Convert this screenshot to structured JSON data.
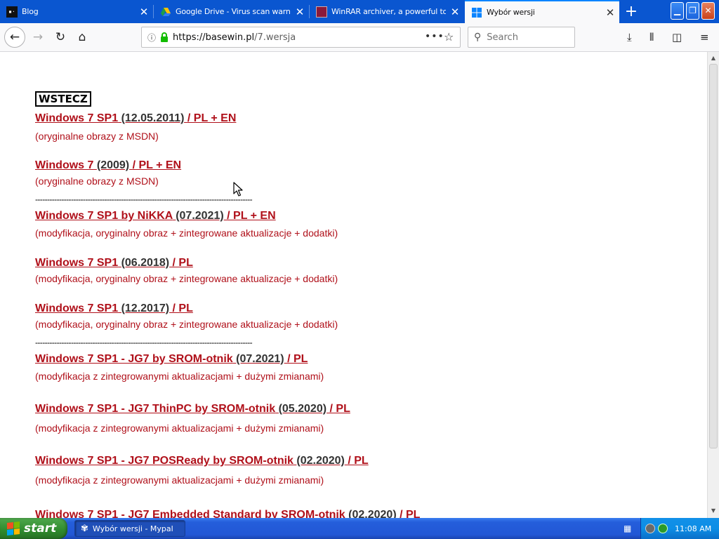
{
  "browser": {
    "tabs": [
      {
        "title": "Blog",
        "icon": "blog-favicon-icon",
        "active": false
      },
      {
        "title": "Google Drive - Virus scan warning",
        "icon": "google-drive-icon",
        "active": false
      },
      {
        "title": "WinRAR archiver, a powerful tool",
        "icon": "winrar-icon",
        "active": false
      },
      {
        "title": "Wybór wersji",
        "icon": "windows-logo-icon",
        "active": true
      }
    ],
    "url_host": "https://basewin.pl",
    "url_path": "/7.wersja",
    "search_placeholder": "Search"
  },
  "page": {
    "back_link": "WSTECZ",
    "entries": [
      {
        "name": "Windows 7 SP1",
        "date": "(12.05.2011)",
        "lang": "/ PL + EN",
        "desc": "(oryginalne obrazy z MSDN)"
      },
      {
        "name": "Windows 7",
        "date": "(2009)",
        "lang": "/ PL + EN",
        "desc": "(oryginalne obrazy z MSDN)"
      },
      {
        "name": "Windows 7 SP1 by NiKKA",
        "date": "(07.2021)",
        "lang": "/ PL + EN",
        "desc": "(modyfikacja, oryginalny obraz + zintegrowane aktualizacje + dodatki)"
      },
      {
        "name": "Windows 7 SP1",
        "date": "(06.2018)",
        "lang": "/ PL",
        "desc": "(modyfikacja, oryginalny obraz + zintegrowane aktualizacje + dodatki)"
      },
      {
        "name": "Windows 7 SP1",
        "date": "(12.2017)",
        "lang": "/ PL",
        "desc": "(modyfikacja, oryginalny obraz + zintegrowane aktualizacje + dodatki)"
      },
      {
        "name": "Windows 7 SP1 - JG7 by SROM-otnik",
        "date": "(07.2021)",
        "lang": "/ PL",
        "desc": "(modyfikacja z zintegrowanymi aktualizacjami + dużymi zmianami)"
      },
      {
        "name": "Windows 7 SP1 - JG7 ThinPC by SROM-otnik",
        "date": "(05.2020)",
        "lang": "/ PL",
        "desc": "(modyfikacja z zintegrowanymi aktualizacjami + dużymi zmianami)"
      },
      {
        "name": "Windows 7 SP1 - JG7 POSReady by SROM-otnik",
        "date": "(02.2020)",
        "lang": "/ PL",
        "desc": "(modyfikacja z zintegrowanymi aktualizacjami + dużymi zmianami)"
      },
      {
        "name": "Windows 7 SP1 - JG7 Embedded Standard by SROM-otnik",
        "date": "(02.2020)",
        "lang": "/ PL",
        "desc": ""
      }
    ],
    "divider": "-------------------------------------------------------------------------------------------"
  },
  "taskbar": {
    "start_label": "start",
    "task_label": "Wybór wersji - Mypal",
    "clock": "11:08 AM"
  },
  "colors": {
    "link_red": "#b0101a",
    "tabbar_blue": "#0a56d0",
    "taskbar_blue": "#245edb",
    "start_green": "#2f8a2d"
  }
}
